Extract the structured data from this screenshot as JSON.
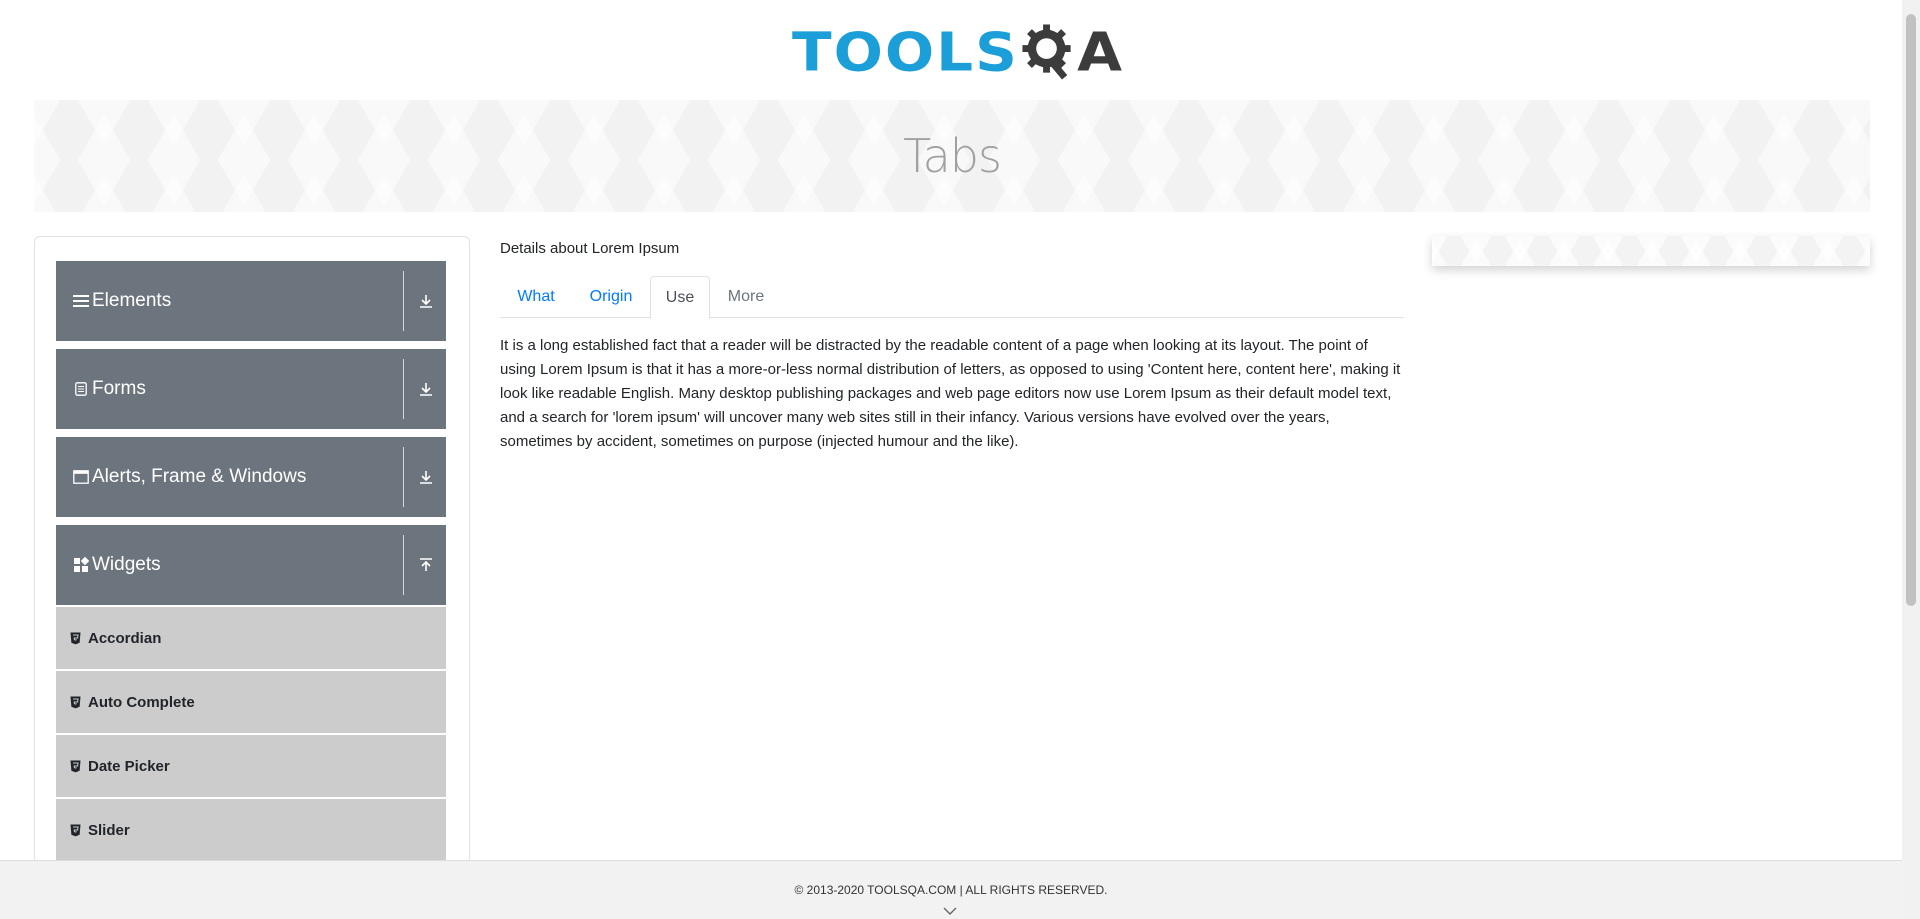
{
  "header": {
    "logo_text_left": "TOOLS",
    "logo_text_right": "A"
  },
  "banner": {
    "title": "Tabs"
  },
  "sidebar": {
    "groups": [
      {
        "label": "Elements",
        "icon": "hamburger-icon"
      },
      {
        "label": "Forms",
        "icon": "document-icon"
      },
      {
        "label": "Alerts, Frame & Windows",
        "icon": "window-icon"
      },
      {
        "label": "Widgets",
        "icon": "widgets-icon"
      }
    ],
    "widget_items": [
      {
        "label": "Accordian"
      },
      {
        "label": "Auto Complete"
      },
      {
        "label": "Date Picker"
      },
      {
        "label": "Slider"
      }
    ]
  },
  "main": {
    "details_title": "Details about Lorem Ipsum",
    "tabs": [
      {
        "label": "What",
        "state": "link"
      },
      {
        "label": "Origin",
        "state": "link"
      },
      {
        "label": "Use",
        "state": "active"
      },
      {
        "label": "More",
        "state": "disabled"
      }
    ],
    "content": "It is a long established fact that a reader will be distracted by the readable content of a page when looking at its layout. The point of using Lorem Ipsum is that it has a more-or-less normal distribution of letters, as opposed to using 'Content here, content here', making it look like readable English. Many desktop publishing packages and web page editors now use Lorem Ipsum as their default model text, and a search for 'lorem ipsum' will uncover many web sites still in their infancy. Various versions have evolved over the years, sometimes by accident, sometimes on purpose (injected humour and the like)."
  },
  "footer": {
    "copyright": "© 2013-2020 TOOLSQA.COM | ALL RIGHTS RESERVED."
  },
  "colors": {
    "logo_blue": "#1c9fd8",
    "logo_dark": "#3c3c3c",
    "group_bg": "#6c757d",
    "sub_bg": "#cccccc",
    "link": "#007bff"
  }
}
